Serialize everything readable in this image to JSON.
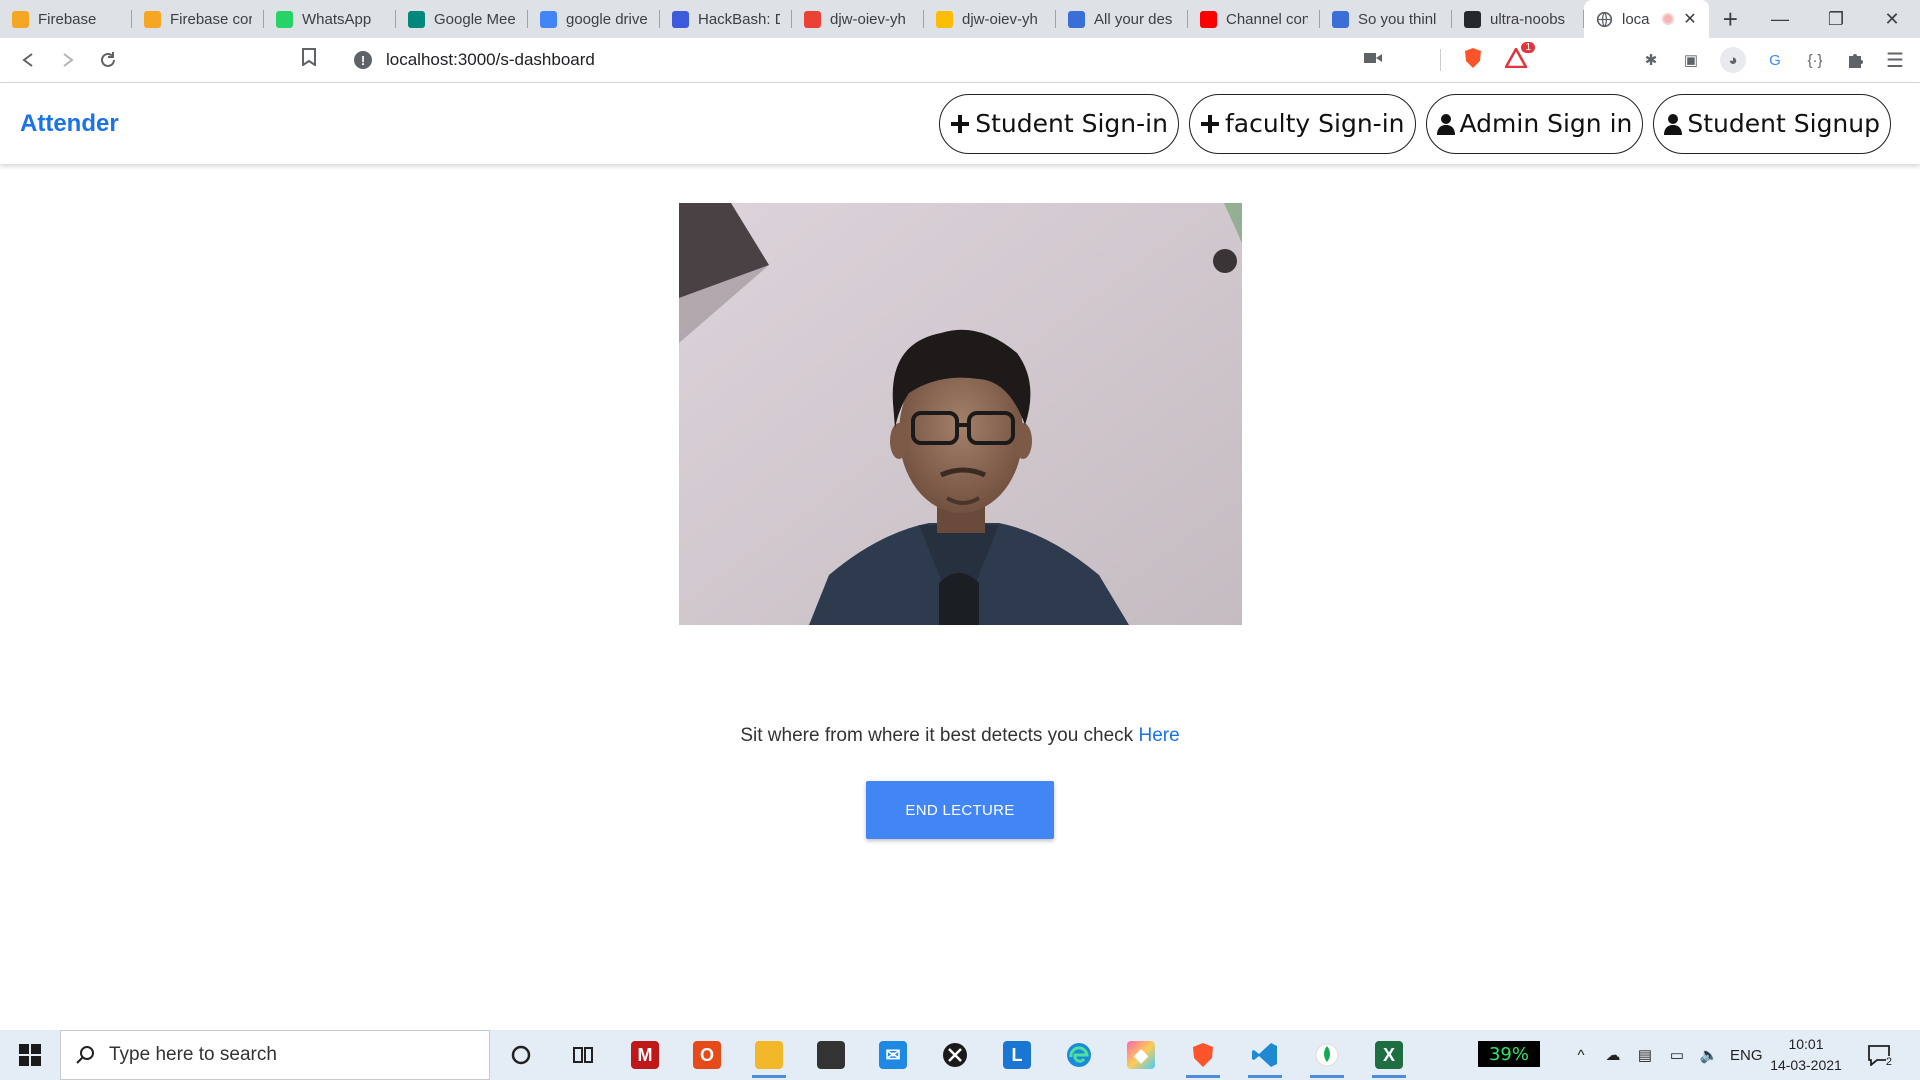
{
  "browser": {
    "tabs": [
      {
        "title": "Firebase",
        "icon": "firebase-icon",
        "color": "#f5a623"
      },
      {
        "title": "Firebase cor",
        "icon": "firebase-icon",
        "color": "#f5a623"
      },
      {
        "title": "WhatsApp",
        "icon": "whatsapp-icon",
        "color": "#25d366"
      },
      {
        "title": "Google Mee",
        "icon": "google-meet-icon",
        "color": "#00897b"
      },
      {
        "title": "google drive",
        "icon": "google-icon",
        "color": "#4285f4"
      },
      {
        "title": "HackBash: D",
        "icon": "hackbash-icon",
        "color": "#3b5bdb"
      },
      {
        "title": "djw-oiev-yh",
        "icon": "gmail-icon",
        "color": "#ea4335"
      },
      {
        "title": "djw-oiev-yh",
        "icon": "google-drive-icon",
        "color": "#fbbc04"
      },
      {
        "title": "All your des",
        "icon": "c-icon",
        "color": "#3b6fd8"
      },
      {
        "title": "Channel con",
        "icon": "youtube-icon",
        "color": "#ff0000"
      },
      {
        "title": "So you thinl",
        "icon": "c-icon",
        "color": "#3b6fd8"
      },
      {
        "title": "ultra-noobs",
        "icon": "github-icon",
        "color": "#24292e"
      }
    ],
    "active_tab": {
      "title": "loca",
      "icon": "globe-icon"
    },
    "url": "localhost:3000/s-dashboard",
    "brave_badge": "1"
  },
  "app": {
    "brand": "Attender",
    "nav_buttons": [
      {
        "label": "Student Sign-in",
        "icon": "plus-icon"
      },
      {
        "label": "faculty Sign-in",
        "icon": "plus-icon"
      },
      {
        "label": "Admin Sign in",
        "icon": "user-icon"
      },
      {
        "label": "Student Signup",
        "icon": "user-icon"
      }
    ],
    "instruction_text": "Sit where from where it best detects you check ",
    "instruction_link": "Here",
    "end_button": "END LECTURE",
    "accent_color": "#4285f4"
  },
  "taskbar": {
    "search_placeholder": "Type here to search",
    "battery": "39%",
    "language": "ENG",
    "time": "10:01",
    "date": "14-03-2021",
    "notifications": "2"
  }
}
